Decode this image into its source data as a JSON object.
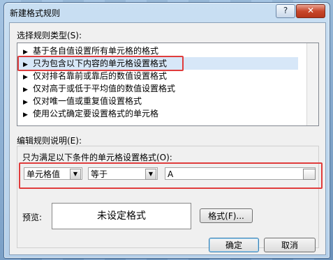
{
  "window": {
    "title": "新建格式规则",
    "help_label": "?",
    "close_label": "✕"
  },
  "rule_type": {
    "label": "选择规则类型(S):",
    "items": [
      "基于各自值设置所有单元格的格式",
      "只为包含以下内容的单元格设置格式",
      "仅对排名靠前或靠后的数值设置格式",
      "仅对高于或低于平均值的数值设置格式",
      "仅对唯一值或重复值设置格式",
      "使用公式确定要设置格式的单元格"
    ],
    "selected_index": 1
  },
  "description": {
    "label": "编辑规则说明(E):",
    "condition_label": "只为满足以下条件的单元格设置格式(O):",
    "field_combo": "单元格值",
    "operator_combo": "等于",
    "value_input": "A"
  },
  "preview": {
    "label": "预览:",
    "text": "未设定格式",
    "format_button": "格式(F)..."
  },
  "buttons": {
    "ok": "确定",
    "cancel": "取消"
  },
  "colors": {
    "highlight": "#e03c3c",
    "selection": "#d7e7f8"
  }
}
